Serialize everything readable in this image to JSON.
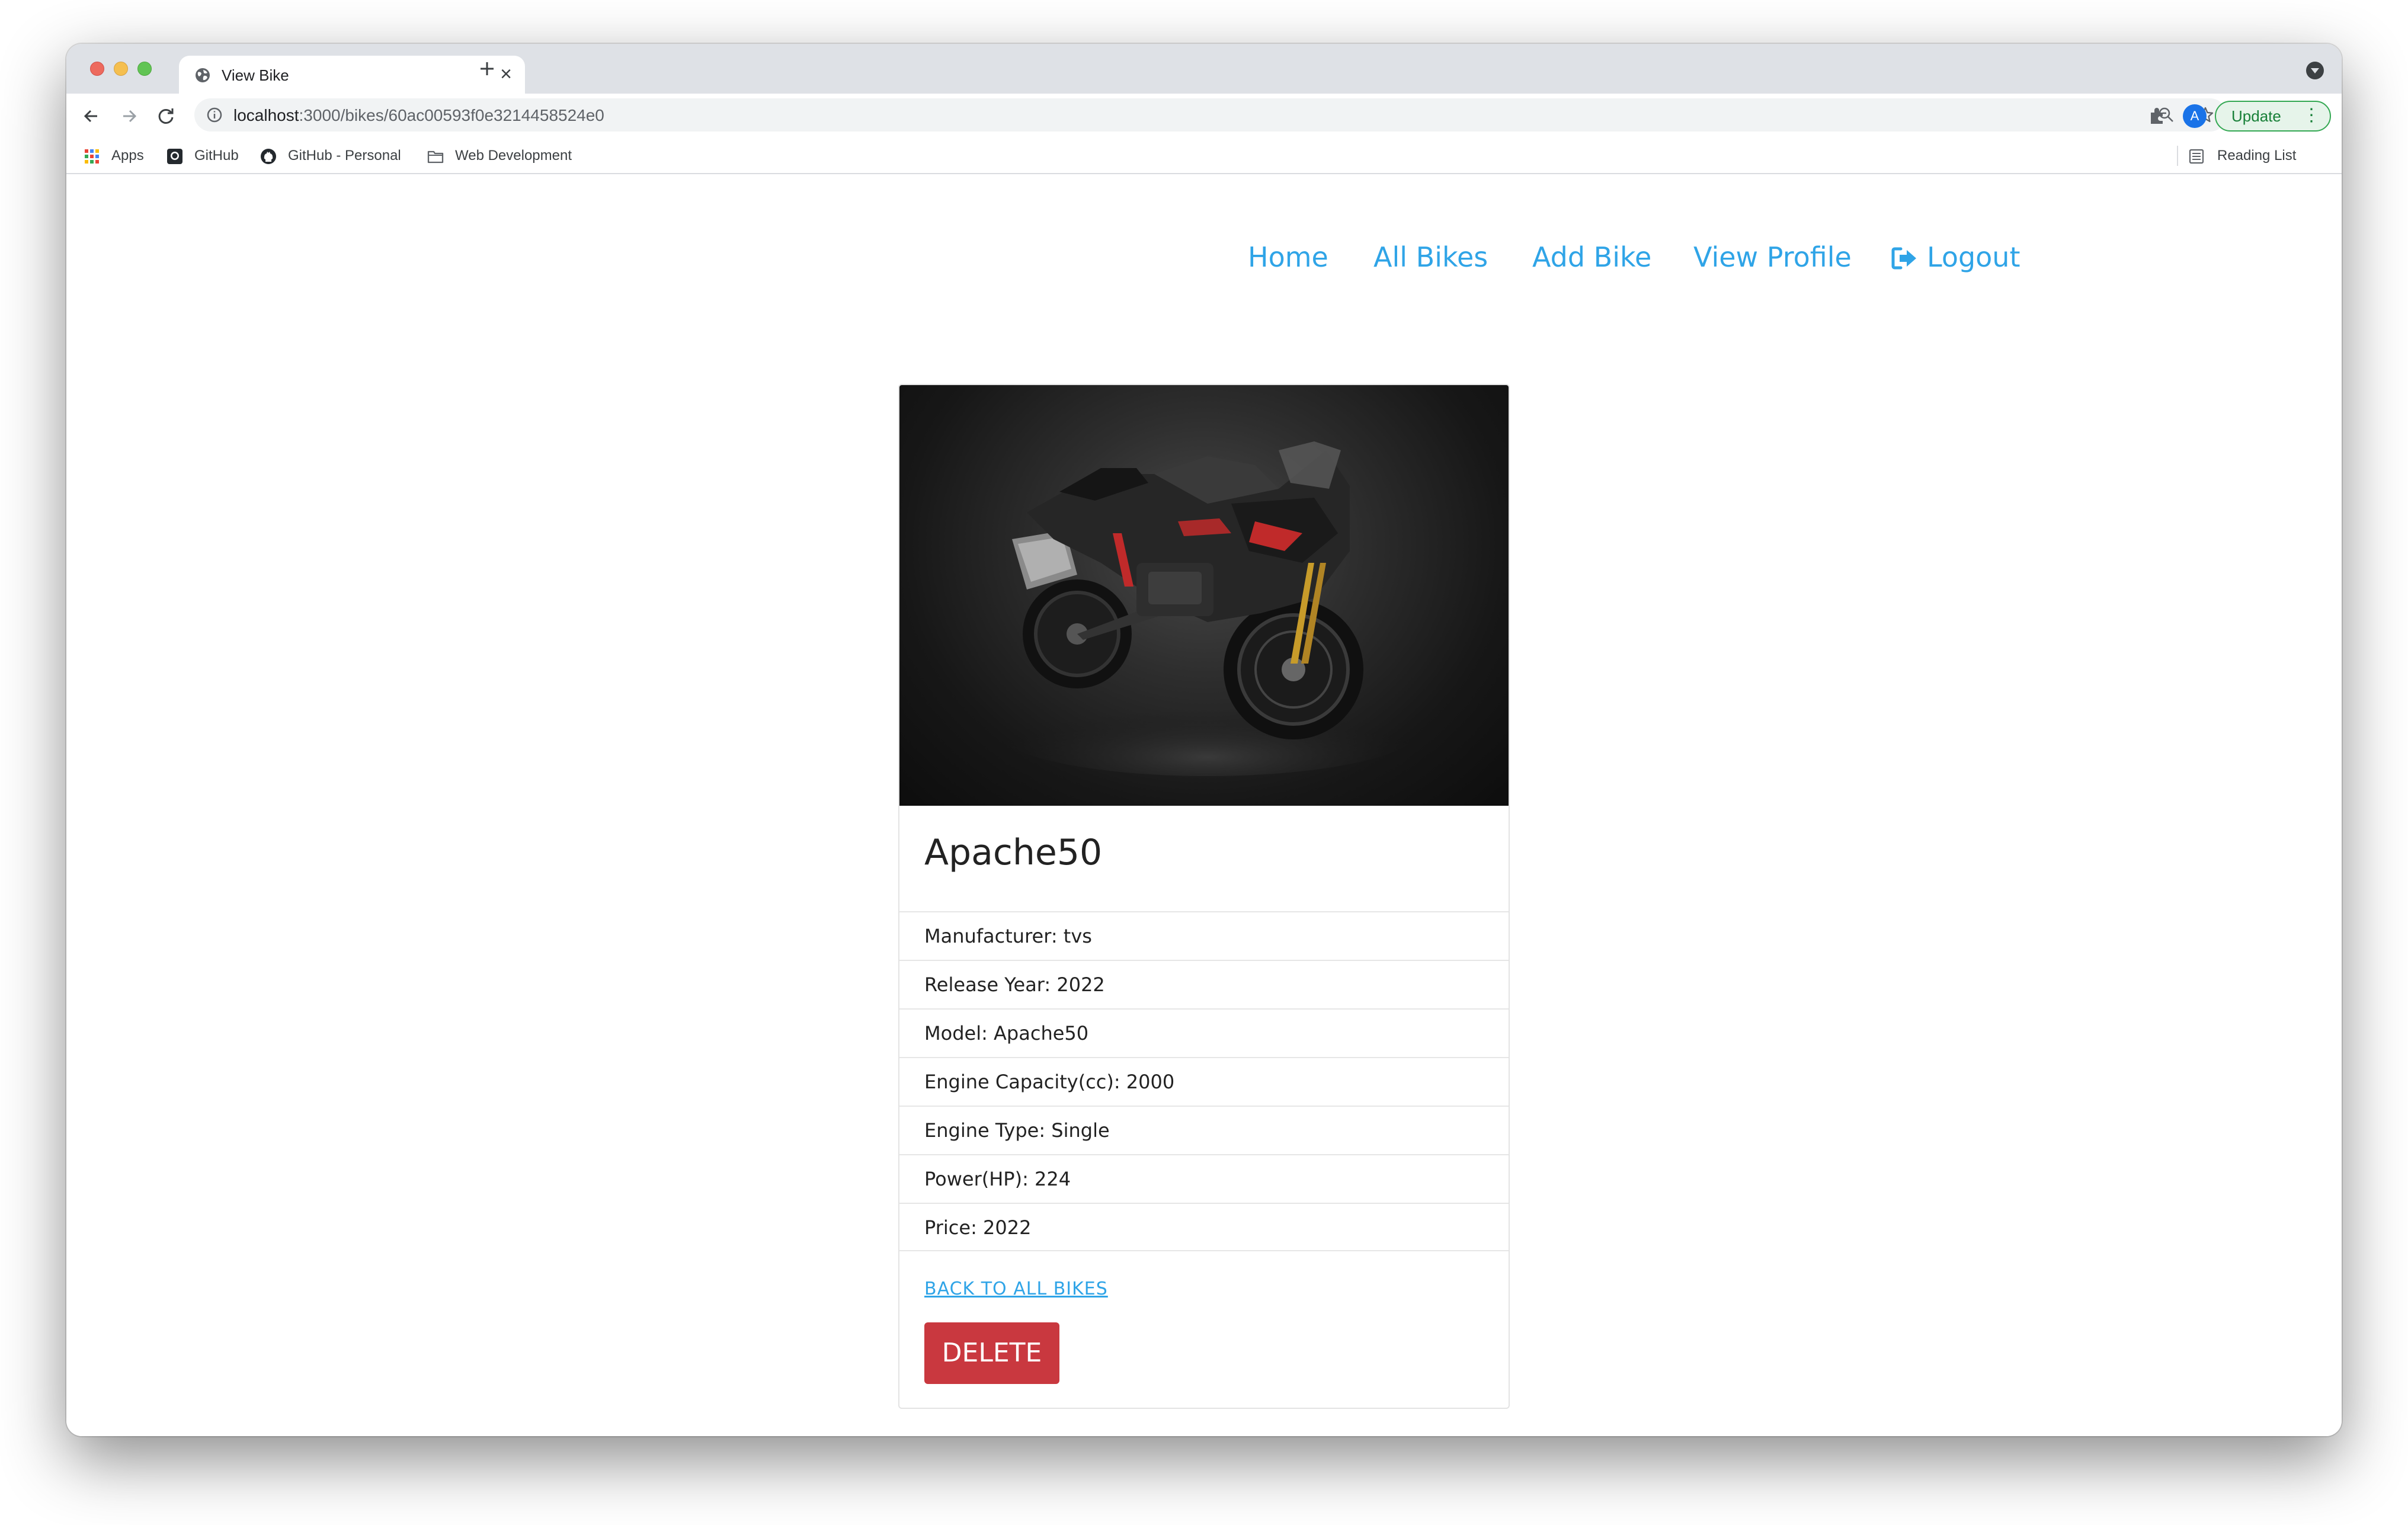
{
  "browser": {
    "tab_title": "View Bike",
    "url_host": "localhost",
    "url_path": ":3000/bikes/60ac00593f0e3214458524e0",
    "avatar_letter": "A",
    "update_label": "Update",
    "bookmarks": [
      "Apps",
      "GitHub",
      "GitHub - Personal",
      "Web Development"
    ],
    "reading_list": "Reading List"
  },
  "nav": {
    "home": "Home",
    "all_bikes": "All Bikes",
    "add_bike": "Add Bike",
    "view_profile": "View Profile",
    "logout": "Logout"
  },
  "bike": {
    "name": "Apache50",
    "specs": [
      "Manufacturer: tvs",
      "Release Year: 2022",
      "Model: Apache50",
      "Engine Capacity(cc): 2000",
      "Engine Type: Single",
      "Power(HP): 224",
      "Price: 2022"
    ],
    "back_link": "BACK TO ALL BIKES",
    "delete_label": "DELETE"
  },
  "colors": {
    "link": "#2fa4e7",
    "delete": "#c9383f"
  }
}
